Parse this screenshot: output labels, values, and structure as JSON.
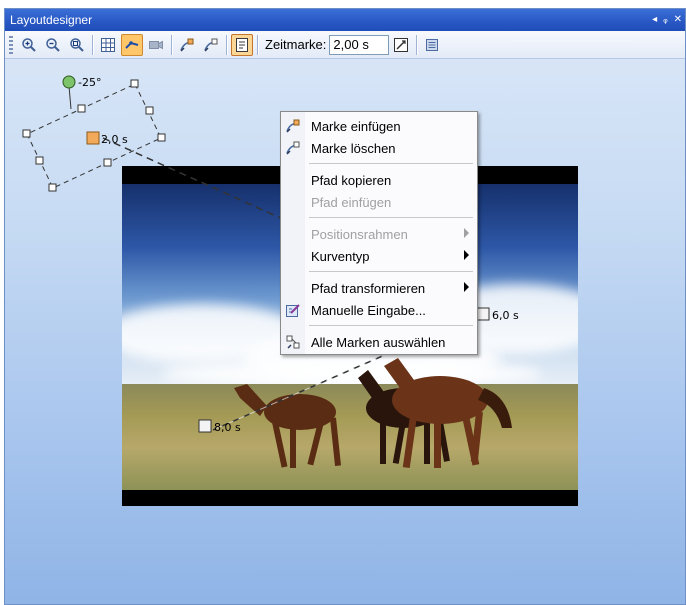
{
  "window": {
    "title": "Layoutdesigner",
    "controls": [
      "◂",
      "ᵩ",
      "✕"
    ]
  },
  "toolbar": {
    "zeitmarke_label": "Zeitmarke:",
    "zeitmarke_value": "2,00 s",
    "icons": [
      "zoom-in-icon",
      "zoom-out-icon",
      "zoom-fit-icon",
      "grid-icon",
      "path-mode-icon",
      "camera-icon",
      "insert-mark-icon",
      "delete-mark-icon",
      "context-menu-icon",
      "time-edit-icon",
      "list-icon"
    ]
  },
  "canvas": {
    "rotation_label": "-25°",
    "marker_start_label": "2,0 s",
    "marker_mid_label": "6,0 s",
    "marker_end_label": "8,0 s"
  },
  "context_menu": {
    "items": [
      {
        "label": "Marke einfügen",
        "icon": "insert-mark-icon",
        "enabled": true,
        "submenu": false
      },
      {
        "label": "Marke löschen",
        "icon": "delete-mark-icon",
        "enabled": true,
        "submenu": false
      },
      {
        "label": "Pfad kopieren",
        "icon": "",
        "enabled": true,
        "submenu": false
      },
      {
        "label": "Pfad einfügen",
        "icon": "",
        "enabled": false,
        "submenu": false
      },
      {
        "label": "Positionsrahmen",
        "icon": "",
        "enabled": false,
        "submenu": true
      },
      {
        "label": "Kurventyp",
        "icon": "",
        "enabled": true,
        "submenu": true
      },
      {
        "label": "Pfad transformieren",
        "icon": "",
        "enabled": true,
        "submenu": true
      },
      {
        "label": "Manuelle Eingabe...",
        "icon": "manual-input-icon",
        "enabled": true,
        "submenu": false
      },
      {
        "label": "Alle Marken auswählen",
        "icon": "select-all-marks-icon",
        "enabled": true,
        "submenu": false
      }
    ]
  },
  "colors": {
    "titlebar": "#2a59c6",
    "active_button": "#ffc66a",
    "marker_orange": "#f2a95a",
    "rotation_handle": "#7cc36a"
  }
}
